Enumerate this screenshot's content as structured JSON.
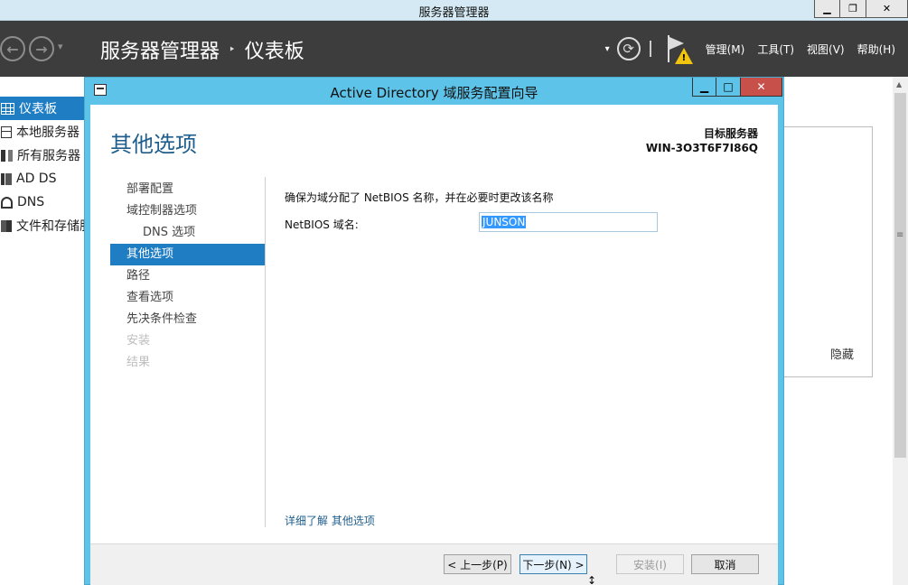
{
  "window": {
    "title": "服务器管理器",
    "controls": {
      "minimize": "▁",
      "restore": "❐",
      "close": "✕"
    }
  },
  "header": {
    "breadcrumb_root": "服务器管理器",
    "breadcrumb_sep": "‣",
    "breadcrumb_current": "仪表板",
    "menus": [
      "管理(M)",
      "工具(T)",
      "视图(V)",
      "帮助(H)"
    ]
  },
  "sidebar": {
    "items": [
      {
        "label": "仪表板",
        "icon": "dashboard-grid-icon",
        "active": true
      },
      {
        "label": "本地服务器",
        "icon": "server-icon",
        "active": false
      },
      {
        "label": "所有服务器",
        "icon": "servers-icon",
        "active": false
      },
      {
        "label": "AD DS",
        "icon": "ad-ds-icon",
        "active": false
      },
      {
        "label": "DNS",
        "icon": "dns-icon",
        "active": false
      },
      {
        "label": "文件和存储服务",
        "icon": "storage-icon",
        "active": false
      }
    ]
  },
  "background": {
    "hide_label": "隐藏"
  },
  "dialog": {
    "title": "Active Directory 域服务配置向导",
    "controls": {
      "minimize": "▁",
      "maximize": "□",
      "close": "✕"
    },
    "page_heading": "其他选项",
    "target_server_label": "目标服务器",
    "target_server_name": "WIN-3O3T6F7I86Q",
    "steps": [
      {
        "label": "部署配置",
        "state": "normal",
        "sub": false
      },
      {
        "label": "域控制器选项",
        "state": "normal",
        "sub": false
      },
      {
        "label": "DNS 选项",
        "state": "normal",
        "sub": true
      },
      {
        "label": "其他选项",
        "state": "active",
        "sub": false
      },
      {
        "label": "路径",
        "state": "normal",
        "sub": false
      },
      {
        "label": "查看选项",
        "state": "normal",
        "sub": false
      },
      {
        "label": "先决条件检查",
        "state": "normal",
        "sub": false
      },
      {
        "label": "安装",
        "state": "disabled",
        "sub": false
      },
      {
        "label": "结果",
        "state": "disabled",
        "sub": false
      }
    ],
    "instruction": "确保为域分配了 NetBIOS 名称，并在必要时更改该名称",
    "netbios_label": "NetBIOS 域名:",
    "netbios_value": "JUNSON",
    "learn_more": "详细了解 其他选项",
    "buttons": {
      "prev": "< 上一步(P)",
      "next": "下一步(N) >",
      "install": "安装(I)",
      "cancel": "取消"
    }
  }
}
